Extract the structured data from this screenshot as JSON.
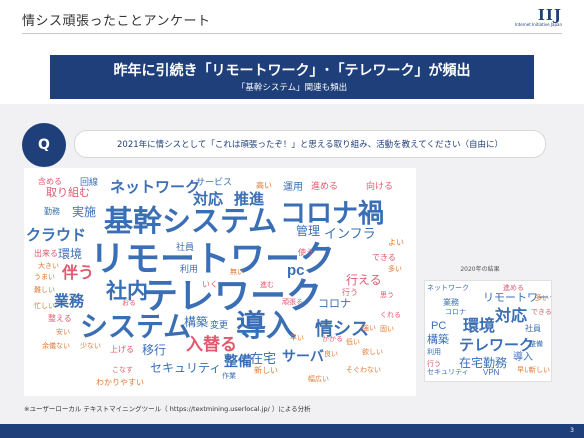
{
  "header": {
    "title": "情シス頑張ったことアンケート",
    "logo_text": "IIJ",
    "logo_sub": "Internet Initiative Japan"
  },
  "banner": {
    "headline": "昨年に引続き「リモートワーク」･「テレワーク」が頻出",
    "subline": "「基幹システム」関連も頻出"
  },
  "question": {
    "badge": "Q",
    "text": "2021年に情シスとして「これは頑張ったぞ！」と思える取り組み、活動を教えてください（自由に）"
  },
  "wordcloud": {
    "words": [
      {
        "t": "基幹システム",
        "c": "#3a6fb5"
      },
      {
        "t": "リモートワーク",
        "c": "#3a6fb5"
      },
      {
        "t": "テレワーク",
        "c": "#3a6fb5"
      },
      {
        "t": "システム",
        "c": "#3a6fb5"
      },
      {
        "t": "導入",
        "c": "#3a6fb5"
      },
      {
        "t": "コロナ禍",
        "c": "#3a6fb5"
      },
      {
        "t": "ネットワーク",
        "c": "#3a6fb5"
      },
      {
        "t": "対応",
        "c": "#3a6fb5"
      },
      {
        "t": "推進",
        "c": "#3a6fb5"
      },
      {
        "t": "クラウド",
        "c": "#3a6fb5"
      },
      {
        "t": "業務",
        "c": "#3a6fb5"
      },
      {
        "t": "社内",
        "c": "#3a6fb5"
      },
      {
        "t": "伴う",
        "c": "#e05a6f"
      },
      {
        "t": "入替る",
        "c": "#e05a6f"
      },
      {
        "t": "構築",
        "c": "#3a6fb5"
      },
      {
        "t": "情シス",
        "c": "#3a6fb5"
      },
      {
        "t": "整備",
        "c": "#3a6fb5"
      },
      {
        "t": "移行",
        "c": "#3a6fb5"
      },
      {
        "t": "セキュリティ",
        "c": "#3a6fb5"
      },
      {
        "t": "サーバ",
        "c": "#3a6fb5"
      },
      {
        "t": "在宅",
        "c": "#3a6fb5"
      },
      {
        "t": "インフラ",
        "c": "#3a6fb5"
      },
      {
        "t": "管理",
        "c": "#3a6fb5"
      },
      {
        "t": "運用",
        "c": "#3a6fb5"
      },
      {
        "t": "pc",
        "c": "#3a6fb5"
      },
      {
        "t": "コロナ",
        "c": "#3a6fb5"
      },
      {
        "t": "行える",
        "c": "#e05a6f"
      },
      {
        "t": "環境",
        "c": "#3a6fb5"
      },
      {
        "t": "実施",
        "c": "#3a6fb5"
      },
      {
        "t": "取り組む",
        "c": "#e05a6f"
      },
      {
        "t": "サービス",
        "c": "#3a6fb5"
      },
      {
        "t": "進める",
        "c": "#e05a6f"
      },
      {
        "t": "向ける",
        "c": "#e05a6f"
      },
      {
        "t": "高い",
        "c": "#e07a35"
      },
      {
        "t": "回線",
        "c": "#3a6fb5"
      },
      {
        "t": "含める",
        "c": "#e05a6f"
      },
      {
        "t": "勤務",
        "c": "#3a6fb5"
      },
      {
        "t": "社員",
        "c": "#3a6fb5"
      },
      {
        "t": "利用",
        "c": "#3a6fb5"
      },
      {
        "t": "出来る",
        "c": "#e05a6f"
      },
      {
        "t": "大きい",
        "c": "#e07a35"
      },
      {
        "t": "うまい",
        "c": "#e07a35"
      },
      {
        "t": "難しい",
        "c": "#e07a35"
      },
      {
        "t": "忙しい",
        "c": "#e07a35"
      },
      {
        "t": "整える",
        "c": "#e05a6f"
      },
      {
        "t": "安い",
        "c": "#e07a35"
      },
      {
        "t": "余儀ない",
        "c": "#e07a35"
      },
      {
        "t": "少ない",
        "c": "#e07a35"
      },
      {
        "t": "上げる",
        "c": "#e05a6f"
      },
      {
        "t": "こなす",
        "c": "#e05a6f"
      },
      {
        "t": "わかりやすい",
        "c": "#e07a35"
      },
      {
        "t": "作業",
        "c": "#3a6fb5"
      },
      {
        "t": "新しい",
        "c": "#e07a35"
      },
      {
        "t": "幅広い",
        "c": "#e07a35"
      },
      {
        "t": "そぐわない",
        "c": "#e07a35"
      },
      {
        "t": "良い",
        "c": "#e07a35"
      },
      {
        "t": "欲しい",
        "c": "#e07a35"
      },
      {
        "t": "くれる",
        "c": "#e05a6f"
      },
      {
        "t": "思う",
        "c": "#e05a6f"
      },
      {
        "t": "行う",
        "c": "#e05a6f"
      },
      {
        "t": "できる",
        "c": "#e05a6f"
      },
      {
        "t": "よい",
        "c": "#e07a35"
      },
      {
        "t": "使う",
        "c": "#e05a6f"
      },
      {
        "t": "頑張る",
        "c": "#e05a6f"
      },
      {
        "t": "無い",
        "c": "#e07a35"
      },
      {
        "t": "いく",
        "c": "#e05a6f"
      },
      {
        "t": "進む",
        "c": "#e05a6f"
      },
      {
        "t": "変更",
        "c": "#3a6fb5"
      },
      {
        "t": "おる",
        "c": "#e05a6f"
      },
      {
        "t": "低い",
        "c": "#e07a35"
      },
      {
        "t": "かかる",
        "c": "#e05a6f"
      },
      {
        "t": "多い",
        "c": "#e07a35"
      },
      {
        "t": "強い",
        "c": "#e07a35"
      },
      {
        "t": "早い",
        "c": "#e07a35"
      },
      {
        "t": "固い",
        "c": "#e07a35"
      }
    ]
  },
  "inset": {
    "label": "2020年の結果",
    "words": [
      {
        "t": "リモートワーク",
        "c": "#3a6fb5"
      },
      {
        "t": "環境",
        "c": "#3a6fb5"
      },
      {
        "t": "対応",
        "c": "#3a6fb5"
      },
      {
        "t": "テレワーク",
        "c": "#3a6fb5"
      },
      {
        "t": "在宅勤務",
        "c": "#3a6fb5"
      },
      {
        "t": "構築",
        "c": "#3a6fb5"
      },
      {
        "t": "導入",
        "c": "#3a6fb5"
      },
      {
        "t": "業務",
        "c": "#3a6fb5"
      },
      {
        "t": "PC",
        "c": "#3a6fb5"
      },
      {
        "t": "VPN",
        "c": "#3a6fb5"
      },
      {
        "t": "社員",
        "c": "#3a6fb5"
      },
      {
        "t": "利用",
        "c": "#3a6fb5"
      },
      {
        "t": "ネットワーク",
        "c": "#3a6fb5"
      },
      {
        "t": "セキュリティ",
        "c": "#3a6fb5"
      },
      {
        "t": "整備",
        "c": "#3a6fb5"
      },
      {
        "t": "コロナ",
        "c": "#3a6fb5"
      },
      {
        "t": "進める",
        "c": "#e05a6f"
      },
      {
        "t": "できる",
        "c": "#e05a6f"
      },
      {
        "t": "行う",
        "c": "#e05a6f"
      },
      {
        "t": "新しい",
        "c": "#e07a35"
      },
      {
        "t": "多い",
        "c": "#e07a35"
      },
      {
        "t": "早い",
        "c": "#e07a35"
      }
    ]
  },
  "footnote": "※ユーザーローカル テキストマイニングツール（ https://textmining.userlocal.jp/ ）による分析",
  "page_number": "3"
}
